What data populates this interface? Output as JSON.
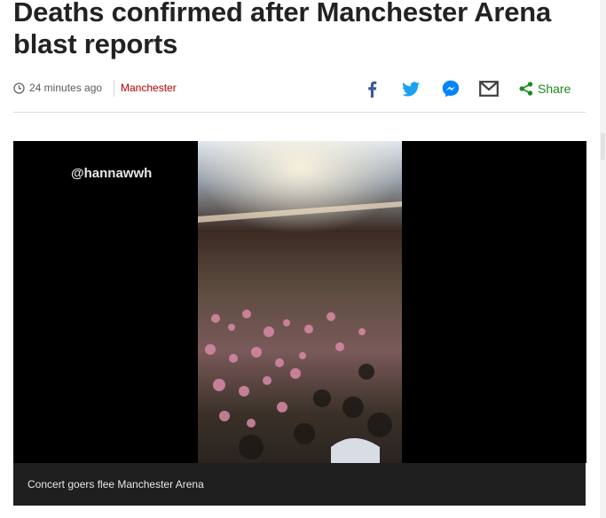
{
  "article": {
    "headline": "Deaths confirmed after Manchester Arena blast reports",
    "timestamp": "24 minutes ago",
    "section": "Manchester"
  },
  "share": {
    "label": "Share",
    "icons": [
      "facebook-icon",
      "twitter-icon",
      "messenger-icon",
      "email-icon",
      "share-icon"
    ],
    "colors": {
      "facebook": "#3b5998",
      "twitter": "#1da1f2",
      "messenger": "#0084ff",
      "email": "#404040",
      "share": "#1e8a1e"
    }
  },
  "media": {
    "watermark": "@hannawwh",
    "caption": "Concert goers flee Manchester Arena"
  },
  "colors": {
    "headline": "#222222",
    "section_link": "#b80000",
    "caption_bg": "#1f1f1f"
  }
}
